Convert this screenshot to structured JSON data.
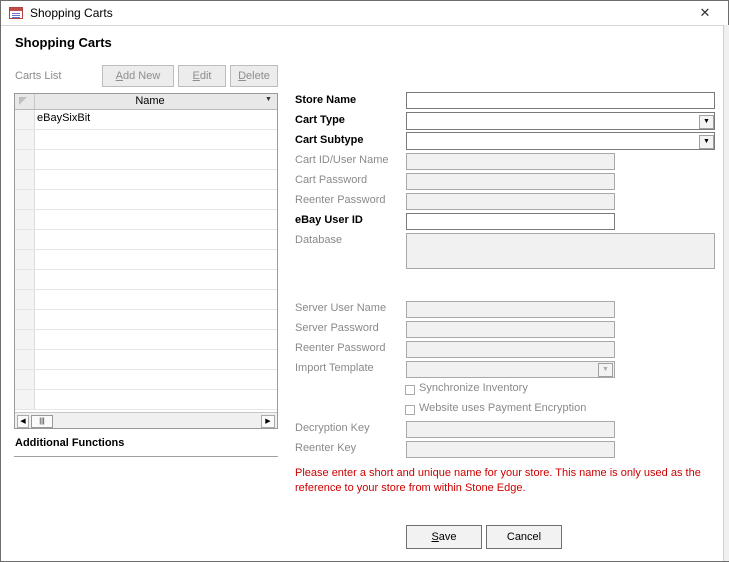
{
  "window": {
    "title": "Shopping Carts",
    "close_glyph": "✕"
  },
  "page": {
    "heading": "Shopping Carts"
  },
  "carts_list": {
    "label": "Carts List",
    "add_new": "Add New",
    "edit": "Edit",
    "delete": "Delete",
    "column_header": "Name",
    "rows": [
      "eBaySixBit"
    ]
  },
  "additional_functions": "Additional Functions",
  "form": {
    "store_name": "Store Name",
    "cart_type": "Cart Type",
    "cart_subtype": "Cart Subtype",
    "cart_id": "Cart ID/User Name",
    "cart_password": "Cart Password",
    "reenter_password": "Reenter Password",
    "ebay_user_id": "eBay User ID",
    "database": "Database",
    "server_user_name": "Server User Name",
    "server_password": "Server Password",
    "server_reenter_password": "Reenter Password",
    "import_template": "Import Template",
    "sync_inventory": "Synchronize Inventory",
    "payment_encryption": "Website uses Payment Encryption",
    "decryption_key": "Decryption Key",
    "reenter_key": "Reenter Key"
  },
  "note": "Please enter a short and unique name for your store. This name is only used as the reference to your store from within Stone Edge.",
  "actions": {
    "save": "Save",
    "cancel": "Cancel"
  },
  "colors": {
    "warning": "#cc0000",
    "disabled_text": "#8a8a8a"
  }
}
